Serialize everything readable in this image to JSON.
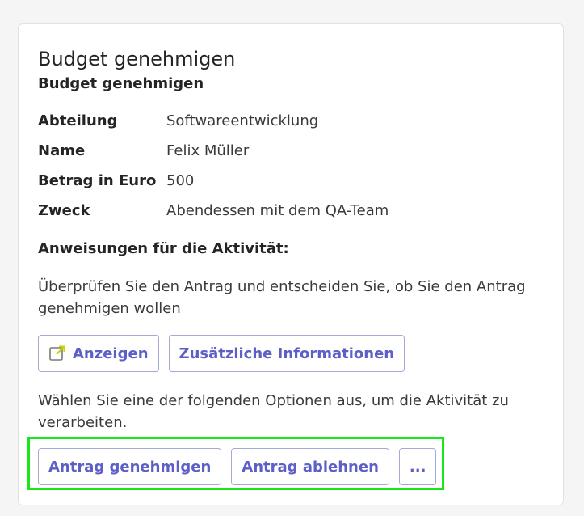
{
  "card": {
    "title": "Budget genehmigen",
    "subtitle": "Budget genehmigen",
    "facts": [
      {
        "key": "Abteilung",
        "value": "Softwareentwicklung"
      },
      {
        "key": "Name",
        "value": "Felix Müller"
      },
      {
        "key": "Betrag in Euro",
        "value": "500"
      },
      {
        "key": "Zweck",
        "value": "Abendessen mit dem QA-Team"
      }
    ],
    "instructions_heading": "Anweisungen für die Aktivität:",
    "instructions_text": "Überprüfen Sie den Antrag und entscheiden Sie, ob Sie den Antrag genehmigen wollen",
    "actions_top": {
      "view_label": "Anzeigen",
      "view_icon": "open-external-icon",
      "more_info_label": "Zusätzliche Informationen"
    },
    "choose_text": "Wählen Sie eine der folgenden Optionen aus, um die Aktivität zu verarbeiten.",
    "actions_bottom": {
      "approve_label": "Antrag genehmigen",
      "reject_label": "Antrag ablehnen",
      "more_label": "..."
    }
  },
  "colors": {
    "accent": "#5b5fc7",
    "button_border": "#a6a8d6",
    "highlight": "#19e619",
    "icon_arrow": "#c8d400"
  }
}
